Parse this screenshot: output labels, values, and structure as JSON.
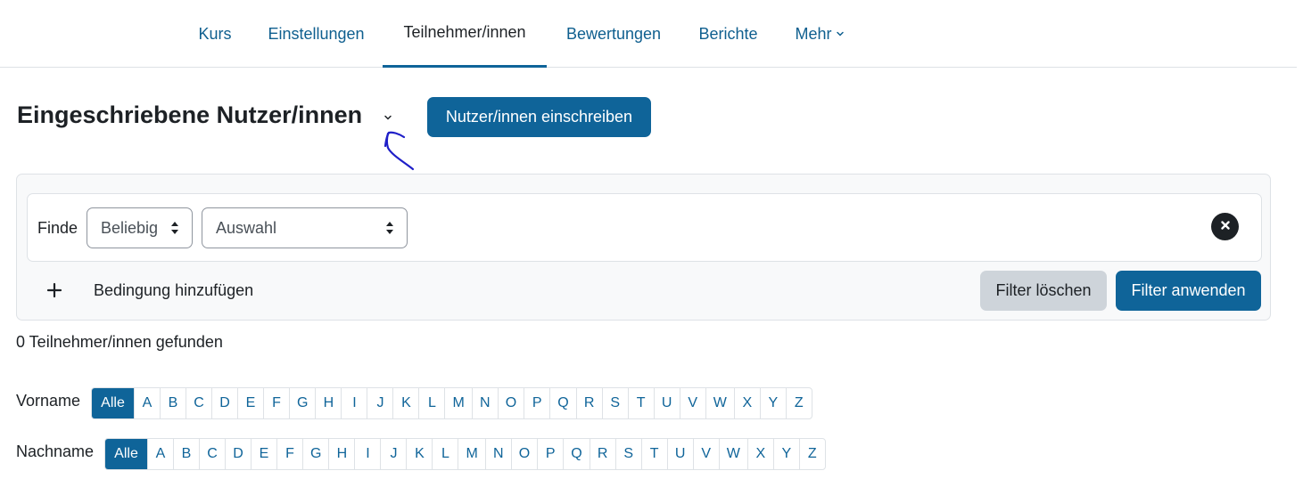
{
  "nav": {
    "tabs": [
      {
        "label": "Kurs"
      },
      {
        "label": "Einstellungen"
      },
      {
        "label": "Teilnehmer/innen"
      },
      {
        "label": "Bewertungen"
      },
      {
        "label": "Berichte"
      },
      {
        "label": "Mehr"
      }
    ],
    "active_tab": "Teilnehmer/innen",
    "accent_color": "#0f6499"
  },
  "header": {
    "title": "Eingeschriebene Nutzer/innen",
    "enrol_button": "Nutzer/innen einschreiben"
  },
  "annotation": {
    "color": "#1f1fc8",
    "shape": "hand-drawn arrow pointing at title dropdown"
  },
  "filter": {
    "find_label": "Finde",
    "match_select": "Beliebig",
    "type_select": "Auswahl",
    "add_condition": "Bedingung hinzufügen",
    "clear_button": "Filter löschen",
    "apply_button": "Filter anwenden"
  },
  "results": {
    "count_text": "0 Teilnehmer/innen gefunden"
  },
  "initials": {
    "firstname_label": "Vorname",
    "lastname_label": "Nachname",
    "all_label": "Alle",
    "letters": [
      "A",
      "B",
      "C",
      "D",
      "E",
      "F",
      "G",
      "H",
      "I",
      "J",
      "K",
      "L",
      "M",
      "N",
      "O",
      "P",
      "Q",
      "R",
      "S",
      "T",
      "U",
      "V",
      "W",
      "X",
      "Y",
      "Z"
    ]
  }
}
